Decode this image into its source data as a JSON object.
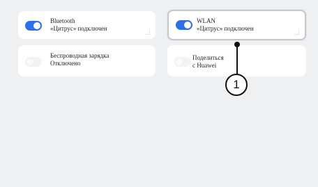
{
  "tiles": [
    {
      "title": "Bluetooth",
      "status": "«Цитрус» подключен",
      "state": "on"
    },
    {
      "title": "WLAN",
      "status": "«Цитрус» подключен",
      "state": "on",
      "selected": true
    },
    {
      "title": "Беспроводная зарядка",
      "status": "Отключено",
      "state": "off"
    },
    {
      "title": "Поделиться",
      "status": "с Huawei",
      "state": "off"
    }
  ],
  "callout": {
    "number": "1"
  },
  "colors": {
    "accent": "#2c6fe8",
    "tile": "#ffffff",
    "background": "#eff0f2"
  }
}
